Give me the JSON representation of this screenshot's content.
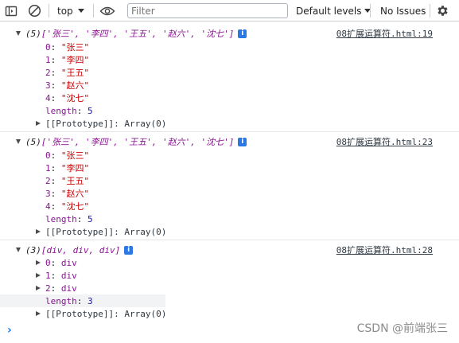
{
  "toolbar": {
    "context": "top",
    "filter_placeholder": "Filter",
    "levels": "Default levels",
    "issues": "No Issues"
  },
  "entries": [
    {
      "summary_prefix": "(5) ",
      "summary": "['张三', '李四', '王五', '赵六', '沈七']",
      "source": "08扩展运算符.html:19",
      "items": [
        {
          "key": "0",
          "value": "\"张三\""
        },
        {
          "key": "1",
          "value": "\"李四\""
        },
        {
          "key": "2",
          "value": "\"王五\""
        },
        {
          "key": "3",
          "value": "\"赵六\""
        },
        {
          "key": "4",
          "value": "\"沈七\""
        }
      ],
      "length_key": "length",
      "length_value": "5",
      "proto": "[[Prototype]]: Array(0)"
    },
    {
      "summary_prefix": "(5) ",
      "summary": "['张三', '李四', '王五', '赵六', '沈七']",
      "source": "08扩展运算符.html:23",
      "items": [
        {
          "key": "0",
          "value": "\"张三\""
        },
        {
          "key": "1",
          "value": "\"李四\""
        },
        {
          "key": "2",
          "value": "\"王五\""
        },
        {
          "key": "3",
          "value": "\"赵六\""
        },
        {
          "key": "4",
          "value": "\"沈七\""
        }
      ],
      "length_key": "length",
      "length_value": "5",
      "proto": "[[Prototype]]: Array(0)"
    },
    {
      "summary_prefix": "(3) ",
      "summary": "[div, div, div]",
      "source": "08扩展运算符.html:28",
      "items": [
        {
          "key": "0",
          "value": "div"
        },
        {
          "key": "1",
          "value": "div"
        },
        {
          "key": "2",
          "value": "div"
        }
      ],
      "length_key": "length",
      "length_value": "3",
      "proto": "[[Prototype]]: Array(0)"
    }
  ],
  "prompt": "›",
  "watermark": "CSDN @前端张三",
  "colors": {
    "key": "#881391",
    "string": "#c80000",
    "number": "#1a1aa6",
    "info_badge": "#2b78e4",
    "prompt": "#1a73e8"
  }
}
